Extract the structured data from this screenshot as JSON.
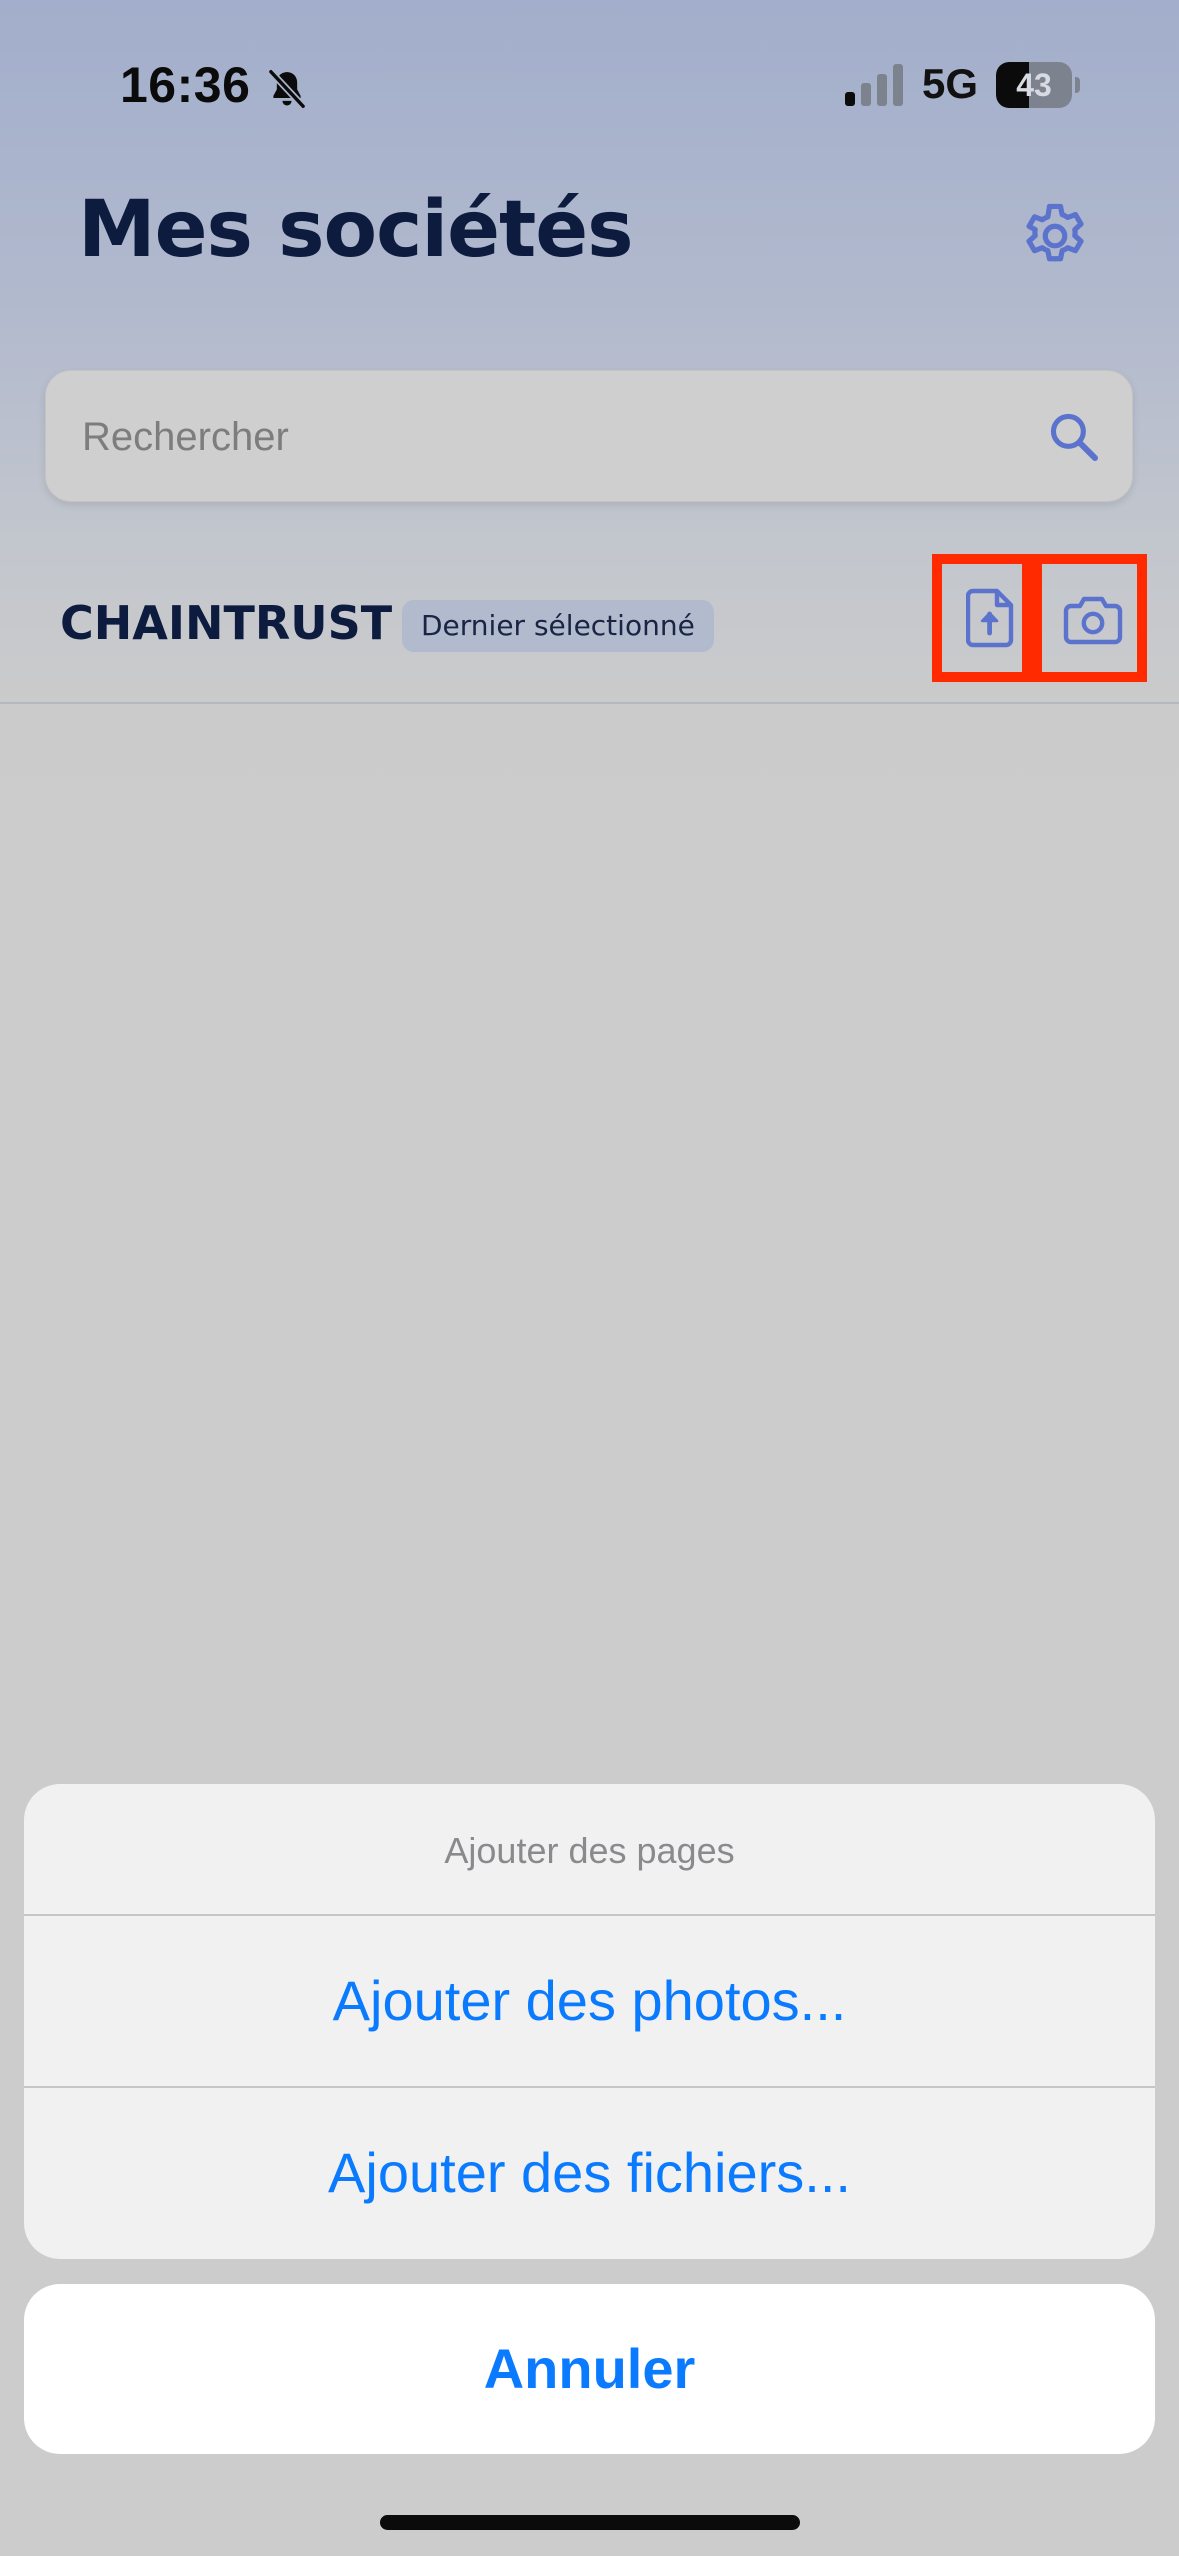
{
  "status_bar": {
    "time": "16:36",
    "network": "5G",
    "battery_level": "43",
    "battery_fraction": 0.43,
    "silent_icon": "bell-slash-icon",
    "signal_icon": "cellular-signal-icon",
    "signal_bars_active": 1,
    "signal_bars_total": 4
  },
  "header": {
    "title": "Mes sociétés",
    "settings_icon": "gear-icon"
  },
  "search": {
    "placeholder": "Rechercher",
    "value": "",
    "icon": "search-icon"
  },
  "companies": [
    {
      "name": "CHAINTRUST",
      "badge": "Dernier sélectionné",
      "actions": [
        {
          "name": "upload-file-icon"
        },
        {
          "name": "camera-icon"
        }
      ]
    }
  ],
  "action_sheet": {
    "title": "Ajouter des pages",
    "options": [
      {
        "label": "Ajouter des photos..."
      },
      {
        "label": "Ajouter des fichiers..."
      }
    ],
    "cancel_label": "Annuler"
  },
  "colors": {
    "accent": "#5b73cc",
    "title": "#0d1b3e",
    "ios_blue": "#0a7aff",
    "highlight": "#ff2a00",
    "sheet_bg": "#f1f1f1"
  }
}
